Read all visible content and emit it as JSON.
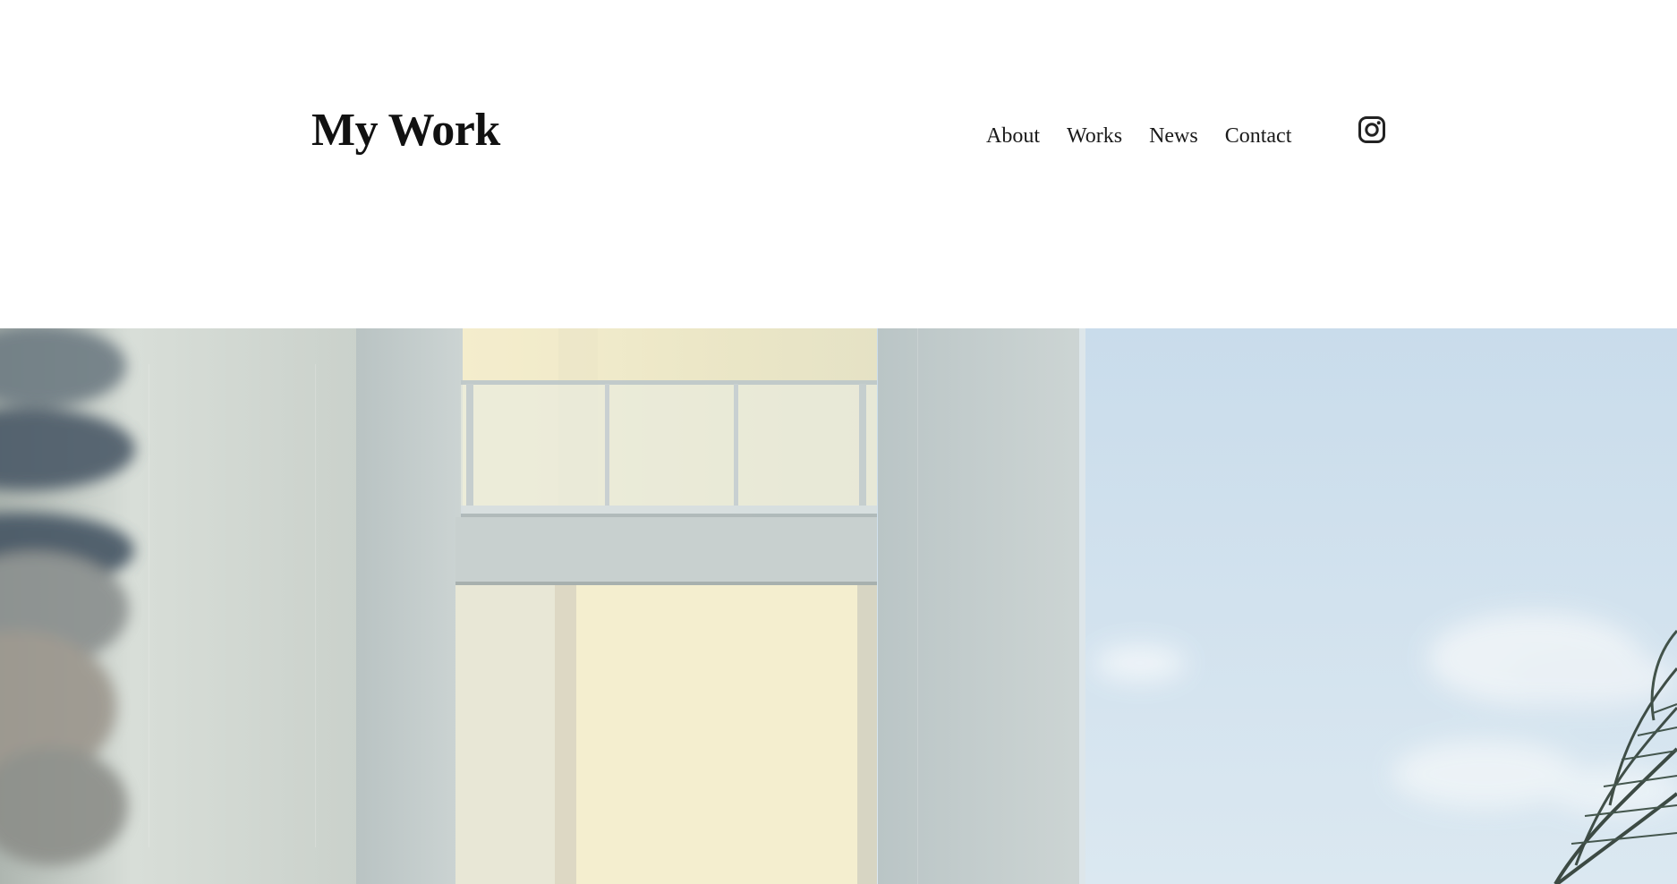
{
  "header": {
    "site_title": "My Work",
    "nav": {
      "items": [
        "About",
        "Works",
        "News",
        "Contact"
      ]
    },
    "social": {
      "icon": "instagram-icon"
    }
  },
  "hero": {
    "image_subject": "white-building-with-balcony-against-sky"
  },
  "colors": {
    "background": "#ffffff",
    "text": "#111111",
    "sky": "#cfe0ec",
    "wall": "#d2dad6",
    "warm_light": "#efe8cb"
  }
}
